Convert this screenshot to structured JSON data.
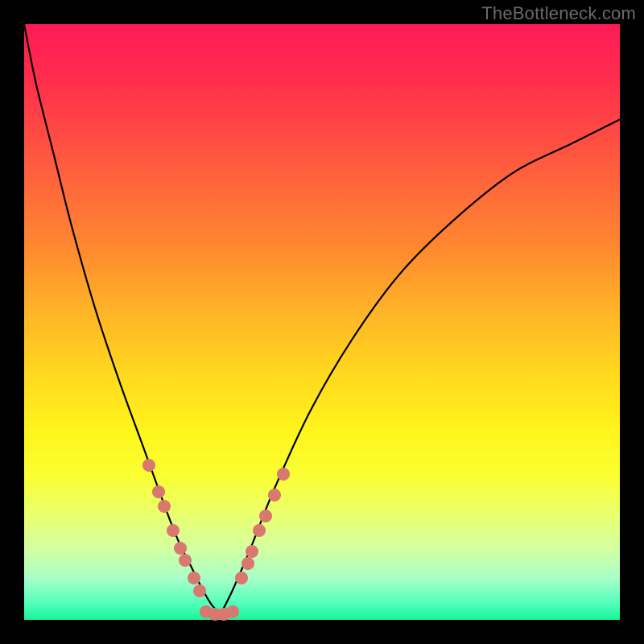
{
  "watermark": "TheBottleneck.com",
  "colors": {
    "frame": "#000000",
    "curve": "#000000",
    "point_fill": "#d8786f",
    "gradient_top": "#ff1a57",
    "gradient_bottom": "#17f59a"
  },
  "chart_data": {
    "type": "line",
    "title": "",
    "xlabel": "",
    "ylabel": "",
    "xlim": [
      0,
      100
    ],
    "ylim": [
      0,
      100
    ],
    "note": "V-shaped bottleneck curve; pink markers cluster near the minimum on both branches. X and Y are approximate percentages of the plot area (origin at bottom-left). Values estimated from pixels — no axis ticks present.",
    "series": [
      {
        "name": "left-branch",
        "x": [
          0,
          2,
          5,
          8,
          12,
          16,
          20,
          24,
          26,
          28,
          30,
          31.5,
          33
        ],
        "y": [
          100,
          90,
          78,
          66,
          52,
          40,
          29,
          18,
          13,
          9,
          5,
          2.5,
          1
        ]
      },
      {
        "name": "right-branch",
        "x": [
          33,
          35,
          38,
          42,
          48,
          55,
          63,
          72,
          82,
          92,
          100
        ],
        "y": [
          1,
          5,
          12,
          22,
          35,
          47,
          58,
          67,
          75,
          80,
          84
        ]
      }
    ],
    "points": [
      {
        "branch": "left",
        "x": 21.0,
        "y": 26.0
      },
      {
        "branch": "left",
        "x": 22.5,
        "y": 21.5
      },
      {
        "branch": "left",
        "x": 23.5,
        "y": 19.0
      },
      {
        "branch": "left",
        "x": 25.0,
        "y": 15.0
      },
      {
        "branch": "left",
        "x": 26.2,
        "y": 12.0
      },
      {
        "branch": "left",
        "x": 27.0,
        "y": 10.0
      },
      {
        "branch": "left",
        "x": 28.5,
        "y": 7.0
      },
      {
        "branch": "left",
        "x": 29.5,
        "y": 4.8
      },
      {
        "branch": "floor",
        "x": 30.5,
        "y": 1.3
      },
      {
        "branch": "floor",
        "x": 32.0,
        "y": 1.0
      },
      {
        "branch": "floor",
        "x": 33.5,
        "y": 1.0
      },
      {
        "branch": "floor",
        "x": 35.0,
        "y": 1.3
      },
      {
        "branch": "right",
        "x": 36.5,
        "y": 7.0
      },
      {
        "branch": "right",
        "x": 37.5,
        "y": 9.5
      },
      {
        "branch": "right",
        "x": 38.2,
        "y": 11.5
      },
      {
        "branch": "right",
        "x": 39.5,
        "y": 15.0
      },
      {
        "branch": "right",
        "x": 40.5,
        "y": 17.5
      },
      {
        "branch": "right",
        "x": 42.0,
        "y": 21.0
      },
      {
        "branch": "right",
        "x": 43.5,
        "y": 24.5
      }
    ]
  }
}
